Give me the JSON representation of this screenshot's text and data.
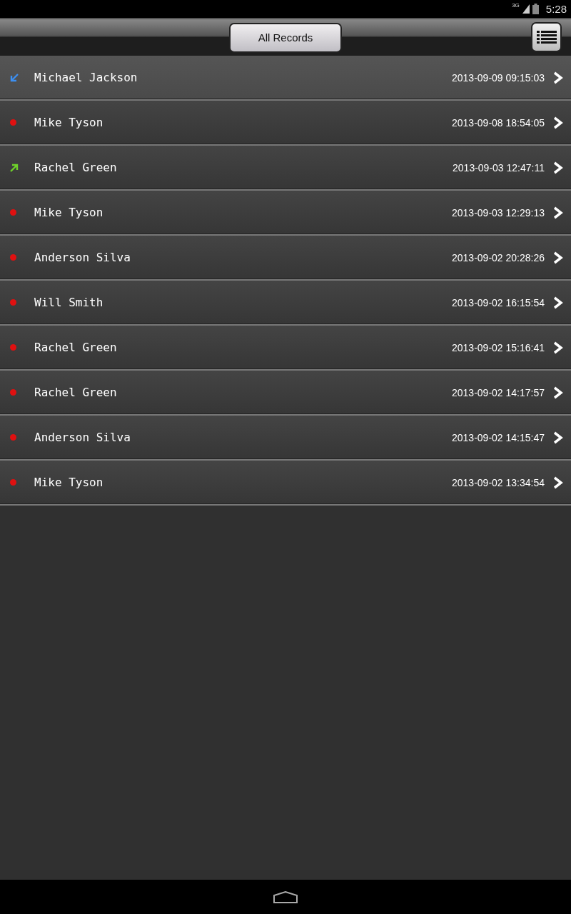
{
  "status_bar": {
    "network": "3G",
    "time": "5:28"
  },
  "toolbar": {
    "title_button": "All Records"
  },
  "records": [
    {
      "kind": "incoming",
      "name": "Michael Jackson",
      "time": "2013-09-09 09:15:03",
      "selected": true
    },
    {
      "kind": "missed",
      "name": "Mike Tyson",
      "time": "2013-09-08 18:54:05",
      "selected": false
    },
    {
      "kind": "outgoing",
      "name": "Rachel Green",
      "time": "2013-09-03 12:47:11",
      "selected": false
    },
    {
      "kind": "missed",
      "name": "Mike Tyson",
      "time": "2013-09-03 12:29:13",
      "selected": false
    },
    {
      "kind": "missed",
      "name": "Anderson Silva",
      "time": "2013-09-02 20:28:26",
      "selected": false
    },
    {
      "kind": "missed",
      "name": "Will Smith",
      "time": "2013-09-02 16:15:54",
      "selected": false
    },
    {
      "kind": "missed",
      "name": "Rachel Green",
      "time": "2013-09-02 15:16:41",
      "selected": false
    },
    {
      "kind": "missed",
      "name": "Rachel Green",
      "time": "2013-09-02 14:17:57",
      "selected": false
    },
    {
      "kind": "missed",
      "name": "Anderson Silva",
      "time": "2013-09-02 14:15:47",
      "selected": false
    },
    {
      "kind": "missed",
      "name": "Mike Tyson",
      "time": "2013-09-02 13:34:54",
      "selected": false
    }
  ]
}
